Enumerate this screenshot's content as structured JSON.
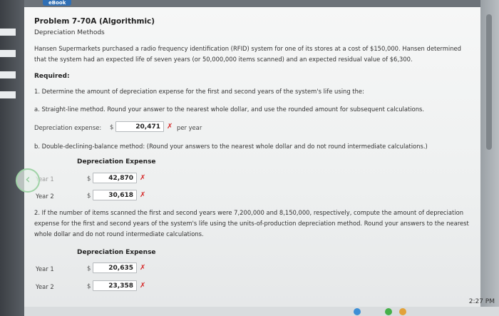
{
  "ebook_tab": "eBook",
  "problem": {
    "title": "Problem 7-70A (Algorithmic)",
    "subtitle": "Depreciation Methods",
    "description": "Hansen Supermarkets purchased a radio frequency identification (RFID) system for one of its stores at a cost of $150,000. Hansen determined that the system had an expected life of seven years (or 50,000,000 items scanned) and an expected residual value of $6,300.",
    "required_label": "Required:",
    "q1": "1. Determine the amount of depreciation expense for the first and second years of the system's life using the:",
    "q1a": "a. Straight-line method. Round your answer to the nearest whole dollar, and use the rounded amount for subsequent calculations.",
    "q1a_label": "Depreciation expense:",
    "q1a_dollar": "$",
    "q1a_value": "20,471",
    "q1a_suffix": "per year",
    "q1b": "b. Double-declining-balance method: (Round your answers to the nearest whole dollar and do not round intermediate calculations.)",
    "table_header": "Depreciation Expense",
    "q1b_rows": [
      {
        "year": "Year 1",
        "dollar": "$",
        "value": "42,870"
      },
      {
        "year": "Year 2",
        "dollar": "$",
        "value": "30,618"
      }
    ],
    "q2": "2. If the number of items scanned the first and second years were 7,200,000 and 8,150,000, respectively, compute the amount of depreciation expense for the first and second years of the system's life using the units-of-production depreciation method. Round your answers to the nearest whole dollar and do not round intermediate calculations.",
    "q2_rows": [
      {
        "year": "Year 1",
        "dollar": "$",
        "value": "20,635"
      },
      {
        "year": "Year 2",
        "dollar": "$",
        "value": "23,358"
      }
    ],
    "incorrect_mark": "✗"
  },
  "system": {
    "clock": "2:27 PM"
  },
  "colors": {
    "incorrect": "#d62b2b",
    "accent": "#2f6fb5"
  }
}
